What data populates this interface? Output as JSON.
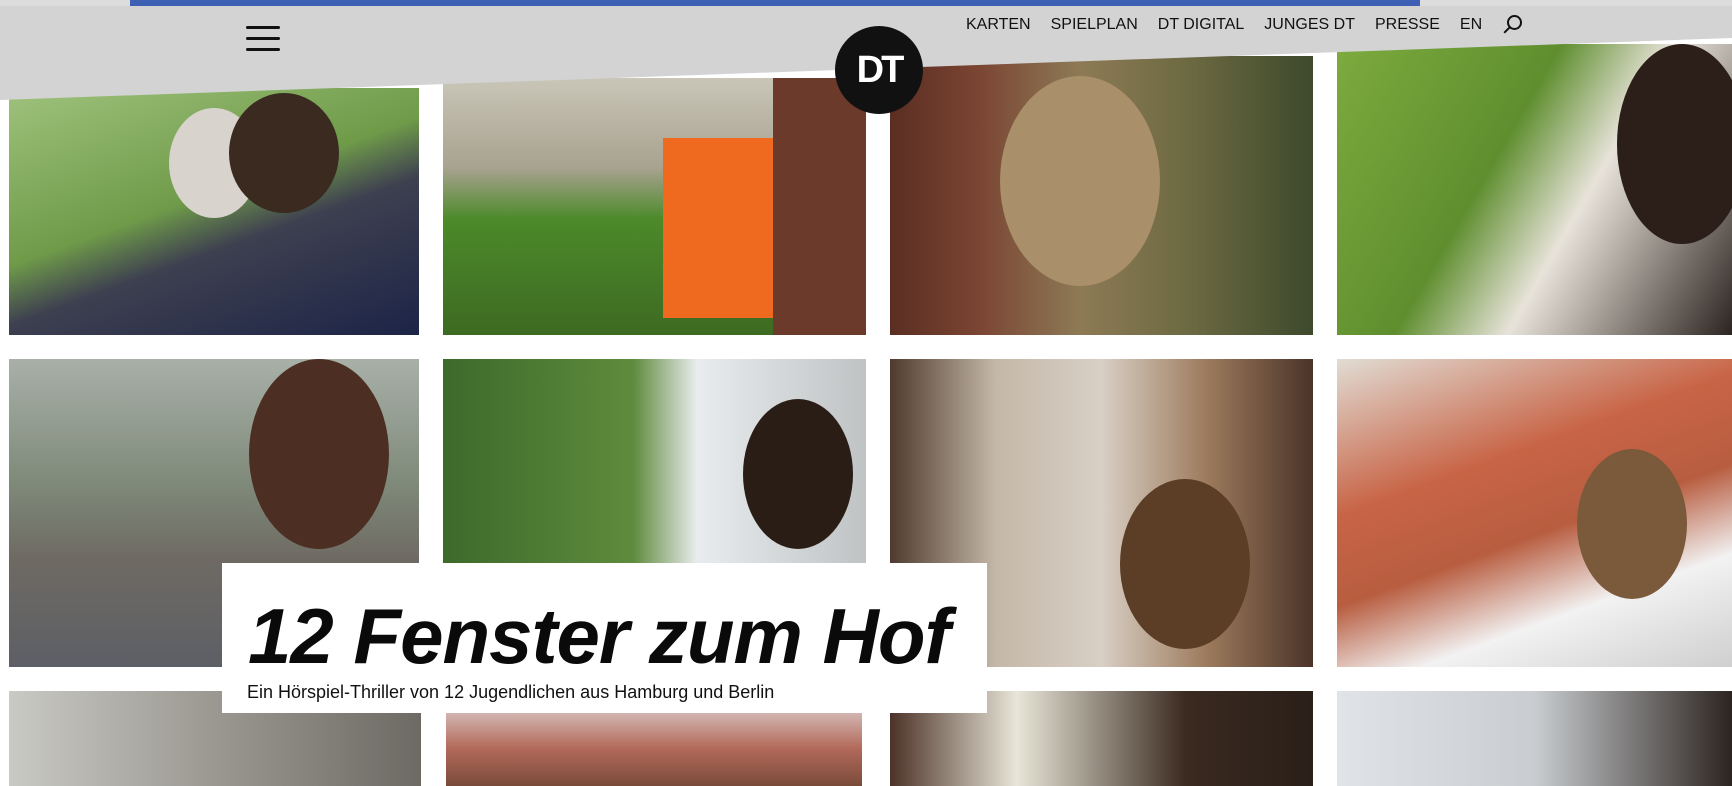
{
  "header": {
    "logo_text": "DT",
    "menu_icon": "hamburger-icon",
    "nav_items": [
      "KARTEN",
      "SPIELPLAN",
      "DT DIGITAL",
      "JUNGES DT",
      "PRESSE",
      "EN"
    ],
    "search_icon": "search-icon"
  },
  "hero": {
    "title": "12 Fenster zum Hof",
    "subtitle": "Ein Hörspiel-Thriller von 12 Jugendlichen aus Hamburg und Berlin"
  },
  "photos": [
    "Jugendliche mit Maske am Balkon",
    "Person in Warnweste am Fenster",
    "Gesicht hinter Fensterscheibe",
    "Person am Fenster mit Vogelhaus",
    "Jugendliche mit Maske im Hof",
    "Jugendliche am offenen Fenster",
    "Person mit Fernglas am Fenster",
    "Person an Fensterscheibe",
    "Fenster mit Lichtstrahlen",
    "Dächer hinter Fenster",
    "Person am Fenster mit Gebäude",
    "Person vor Altbaufassade"
  ],
  "colors": {
    "header_bg": "#d3d3d3",
    "accent_strip": "#3d5fb4",
    "title_text": "#0a0a0a"
  }
}
